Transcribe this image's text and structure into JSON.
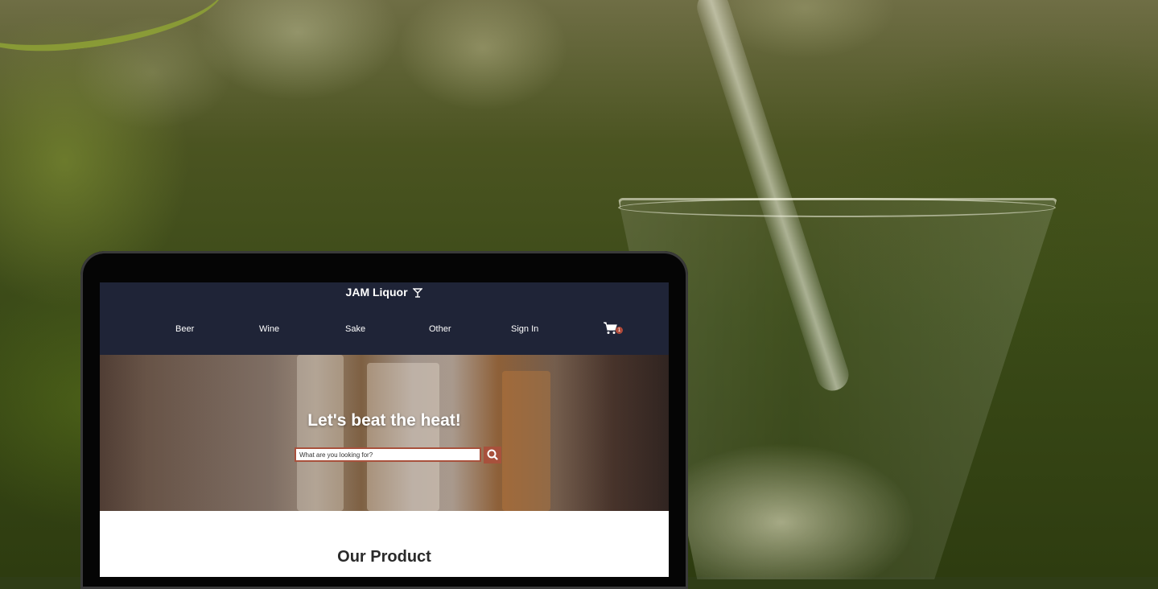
{
  "site": {
    "brand": "JAM Liquor",
    "brand_icon": "cocktail-glass-icon",
    "colors": {
      "nav_bg": "#1f2437",
      "accent": "#a8513c",
      "badge": "#b04a3a"
    }
  },
  "nav": {
    "items": [
      {
        "label": "Beer"
      },
      {
        "label": "Wine"
      },
      {
        "label": "Sake"
      },
      {
        "label": "Other"
      },
      {
        "label": "Sign In"
      }
    ],
    "cart_icon": "shopping-cart-icon",
    "cart_count": "1"
  },
  "hero": {
    "title": "Let's beat the heat!",
    "search": {
      "placeholder": "What are you looking for?",
      "value": "",
      "button_icon": "search-icon"
    }
  },
  "section": {
    "title": "Our Product"
  }
}
